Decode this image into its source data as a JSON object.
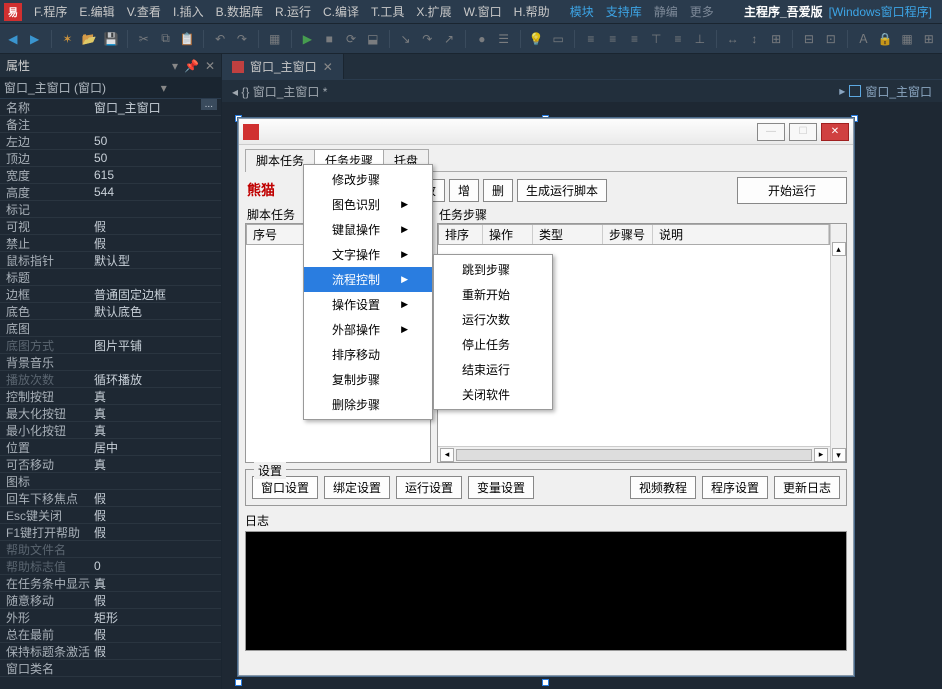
{
  "app": {
    "title": "主程序_吾爱版",
    "subtitle": "[Windows窗口程序]"
  },
  "menubar": {
    "items": [
      "F.程序",
      "E.编辑",
      "V.查看",
      "I.插入",
      "B.数据库",
      "R.运行",
      "C.编译",
      "T.工具",
      "X.扩展",
      "W.窗口",
      "H.帮助"
    ],
    "extras_blue": [
      "模块",
      "支持库"
    ],
    "extras_gray": [
      "静编",
      "更多"
    ]
  },
  "panel": {
    "title": "属性",
    "object": "窗口_主窗口 (窗口)",
    "rows": [
      {
        "k": "名称",
        "v": "窗口_主窗口",
        "ell": true
      },
      {
        "k": "备注",
        "v": ""
      },
      {
        "k": "左边",
        "v": "50"
      },
      {
        "k": "顶边",
        "v": "50"
      },
      {
        "k": "宽度",
        "v": "615"
      },
      {
        "k": "高度",
        "v": "544"
      },
      {
        "k": "标记",
        "v": ""
      },
      {
        "k": "可视",
        "v": "假"
      },
      {
        "k": "禁止",
        "v": "假"
      },
      {
        "k": "鼠标指针",
        "v": "默认型"
      },
      {
        "k": "标题",
        "v": ""
      },
      {
        "k": "边框",
        "v": "普通固定边框"
      },
      {
        "k": "底色",
        "v": "默认底色"
      },
      {
        "k": "底图",
        "v": ""
      },
      {
        "k": "底图方式",
        "v": "图片平铺",
        "dim": true
      },
      {
        "k": "背景音乐",
        "v": ""
      },
      {
        "k": "播放次数",
        "v": "循环播放",
        "dim": true
      },
      {
        "k": "控制按钮",
        "v": "真"
      },
      {
        "k": "最大化按钮",
        "v": "真"
      },
      {
        "k": "最小化按钮",
        "v": "真"
      },
      {
        "k": "位置",
        "v": "居中"
      },
      {
        "k": "可否移动",
        "v": "真"
      },
      {
        "k": "图标",
        "v": ""
      },
      {
        "k": "回车下移焦点",
        "v": "假"
      },
      {
        "k": "Esc键关闭",
        "v": "假"
      },
      {
        "k": "F1键打开帮助",
        "v": "假"
      },
      {
        "k": "帮助文件名",
        "v": "",
        "dim": true
      },
      {
        "k": "帮助标志值",
        "v": "0",
        "dim": true
      },
      {
        "k": "在任务条中显示",
        "v": "真"
      },
      {
        "k": "随意移动",
        "v": "假"
      },
      {
        "k": "外形",
        "v": "矩形"
      },
      {
        "k": "总在最前",
        "v": "假"
      },
      {
        "k": "保持标题条激活",
        "v": "假"
      },
      {
        "k": "窗口类名",
        "v": ""
      }
    ]
  },
  "tabs": {
    "active": "窗口_主窗口",
    "active_star": "*",
    "breadcrumb_left": "{} 窗口_主窗口 *",
    "breadcrumb_right": "窗口_主窗口"
  },
  "form": {
    "tabs": [
      "脚本任务",
      "任务步骤",
      "托盘"
    ],
    "active_tab_index": 1,
    "brand": "熊猫",
    "buttons_mid": [
      "改",
      "增",
      "删"
    ],
    "btn_generate": "生成运行脚本",
    "btn_start": "开始运行",
    "left_pane_title": "脚本任务",
    "left_cols": [
      "序号"
    ],
    "right_pane_title": "任务步骤",
    "right_cols": [
      "排序",
      "操作",
      "类型",
      "步骤号",
      "说明"
    ],
    "group_settings": "设置",
    "settings_buttons": [
      "窗口设置",
      "绑定设置",
      "运行设置",
      "变量设置"
    ],
    "settings_right": [
      "视频教程",
      "程序设置",
      "更新日志"
    ],
    "log_label": "日志"
  },
  "menu1": {
    "items": [
      {
        "label": "修改步骤"
      },
      {
        "label": "图色识别",
        "sub": true
      },
      {
        "label": "键鼠操作",
        "sub": true
      },
      {
        "label": "文字操作",
        "sub": true
      },
      {
        "label": "流程控制",
        "sub": true,
        "hl": true
      },
      {
        "label": "操作设置",
        "sub": true
      },
      {
        "label": "外部操作",
        "sub": true
      },
      {
        "label": "排序移动"
      },
      {
        "label": "复制步骤"
      },
      {
        "label": "删除步骤"
      }
    ]
  },
  "menu2": {
    "items": [
      "跳到步骤",
      "重新开始",
      "运行次数",
      "停止任务",
      "结束运行",
      "关闭软件"
    ]
  }
}
